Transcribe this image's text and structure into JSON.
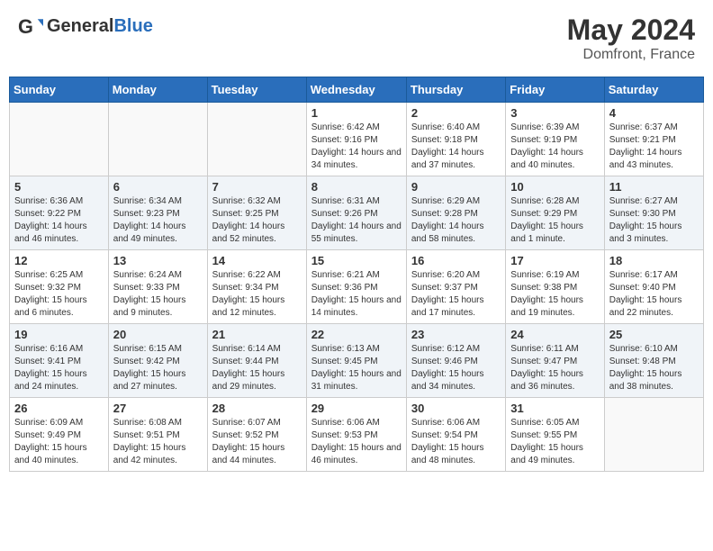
{
  "header": {
    "logo_general": "General",
    "logo_blue": "Blue",
    "month_year": "May 2024",
    "location": "Domfront, France"
  },
  "days_of_week": [
    "Sunday",
    "Monday",
    "Tuesday",
    "Wednesday",
    "Thursday",
    "Friday",
    "Saturday"
  ],
  "weeks": [
    [
      {
        "day": "",
        "info": ""
      },
      {
        "day": "",
        "info": ""
      },
      {
        "day": "",
        "info": ""
      },
      {
        "day": "1",
        "info": "Sunrise: 6:42 AM\nSunset: 9:16 PM\nDaylight: 14 hours and 34 minutes."
      },
      {
        "day": "2",
        "info": "Sunrise: 6:40 AM\nSunset: 9:18 PM\nDaylight: 14 hours and 37 minutes."
      },
      {
        "day": "3",
        "info": "Sunrise: 6:39 AM\nSunset: 9:19 PM\nDaylight: 14 hours and 40 minutes."
      },
      {
        "day": "4",
        "info": "Sunrise: 6:37 AM\nSunset: 9:21 PM\nDaylight: 14 hours and 43 minutes."
      }
    ],
    [
      {
        "day": "5",
        "info": "Sunrise: 6:36 AM\nSunset: 9:22 PM\nDaylight: 14 hours and 46 minutes."
      },
      {
        "day": "6",
        "info": "Sunrise: 6:34 AM\nSunset: 9:23 PM\nDaylight: 14 hours and 49 minutes."
      },
      {
        "day": "7",
        "info": "Sunrise: 6:32 AM\nSunset: 9:25 PM\nDaylight: 14 hours and 52 minutes."
      },
      {
        "day": "8",
        "info": "Sunrise: 6:31 AM\nSunset: 9:26 PM\nDaylight: 14 hours and 55 minutes."
      },
      {
        "day": "9",
        "info": "Sunrise: 6:29 AM\nSunset: 9:28 PM\nDaylight: 14 hours and 58 minutes."
      },
      {
        "day": "10",
        "info": "Sunrise: 6:28 AM\nSunset: 9:29 PM\nDaylight: 15 hours and 1 minute."
      },
      {
        "day": "11",
        "info": "Sunrise: 6:27 AM\nSunset: 9:30 PM\nDaylight: 15 hours and 3 minutes."
      }
    ],
    [
      {
        "day": "12",
        "info": "Sunrise: 6:25 AM\nSunset: 9:32 PM\nDaylight: 15 hours and 6 minutes."
      },
      {
        "day": "13",
        "info": "Sunrise: 6:24 AM\nSunset: 9:33 PM\nDaylight: 15 hours and 9 minutes."
      },
      {
        "day": "14",
        "info": "Sunrise: 6:22 AM\nSunset: 9:34 PM\nDaylight: 15 hours and 12 minutes."
      },
      {
        "day": "15",
        "info": "Sunrise: 6:21 AM\nSunset: 9:36 PM\nDaylight: 15 hours and 14 minutes."
      },
      {
        "day": "16",
        "info": "Sunrise: 6:20 AM\nSunset: 9:37 PM\nDaylight: 15 hours and 17 minutes."
      },
      {
        "day": "17",
        "info": "Sunrise: 6:19 AM\nSunset: 9:38 PM\nDaylight: 15 hours and 19 minutes."
      },
      {
        "day": "18",
        "info": "Sunrise: 6:17 AM\nSunset: 9:40 PM\nDaylight: 15 hours and 22 minutes."
      }
    ],
    [
      {
        "day": "19",
        "info": "Sunrise: 6:16 AM\nSunset: 9:41 PM\nDaylight: 15 hours and 24 minutes."
      },
      {
        "day": "20",
        "info": "Sunrise: 6:15 AM\nSunset: 9:42 PM\nDaylight: 15 hours and 27 minutes."
      },
      {
        "day": "21",
        "info": "Sunrise: 6:14 AM\nSunset: 9:44 PM\nDaylight: 15 hours and 29 minutes."
      },
      {
        "day": "22",
        "info": "Sunrise: 6:13 AM\nSunset: 9:45 PM\nDaylight: 15 hours and 31 minutes."
      },
      {
        "day": "23",
        "info": "Sunrise: 6:12 AM\nSunset: 9:46 PM\nDaylight: 15 hours and 34 minutes."
      },
      {
        "day": "24",
        "info": "Sunrise: 6:11 AM\nSunset: 9:47 PM\nDaylight: 15 hours and 36 minutes."
      },
      {
        "day": "25",
        "info": "Sunrise: 6:10 AM\nSunset: 9:48 PM\nDaylight: 15 hours and 38 minutes."
      }
    ],
    [
      {
        "day": "26",
        "info": "Sunrise: 6:09 AM\nSunset: 9:49 PM\nDaylight: 15 hours and 40 minutes."
      },
      {
        "day": "27",
        "info": "Sunrise: 6:08 AM\nSunset: 9:51 PM\nDaylight: 15 hours and 42 minutes."
      },
      {
        "day": "28",
        "info": "Sunrise: 6:07 AM\nSunset: 9:52 PM\nDaylight: 15 hours and 44 minutes."
      },
      {
        "day": "29",
        "info": "Sunrise: 6:06 AM\nSunset: 9:53 PM\nDaylight: 15 hours and 46 minutes."
      },
      {
        "day": "30",
        "info": "Sunrise: 6:06 AM\nSunset: 9:54 PM\nDaylight: 15 hours and 48 minutes."
      },
      {
        "day": "31",
        "info": "Sunrise: 6:05 AM\nSunset: 9:55 PM\nDaylight: 15 hours and 49 minutes."
      },
      {
        "day": "",
        "info": ""
      }
    ]
  ]
}
